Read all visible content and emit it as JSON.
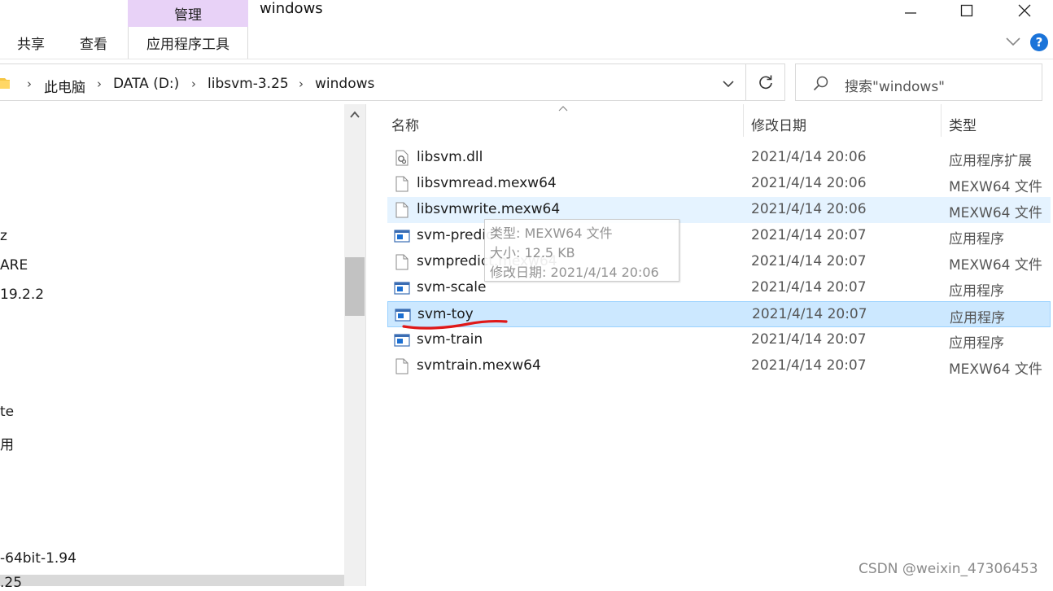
{
  "window": {
    "title": "windows",
    "manage_tab": "管理",
    "minimize_icon": "minimize-icon",
    "maximize_icon": "maximize-icon",
    "close_icon": "close-icon"
  },
  "ribbon": {
    "tabs": [
      "共享",
      "查看"
    ],
    "app_tools_tab": "应用程序工具",
    "help_glyph": "?"
  },
  "address": {
    "breadcrumbs": [
      "此电脑",
      "DATA (D:)",
      "libsvm-3.25",
      "windows"
    ],
    "separator": "›",
    "search_placeholder": "搜索\"windows\""
  },
  "nav": {
    "items": [
      "z",
      "ARE",
      "19.2.2",
      "te",
      "用",
      "-64bit-1.94",
      ".25"
    ]
  },
  "columns": {
    "name": "名称",
    "modified": "修改日期",
    "type": "类型"
  },
  "files": [
    {
      "name": "libsvm.dll",
      "date": "2021/4/14 20:06",
      "type": "应用程序扩展",
      "icon": "dll-file-icon"
    },
    {
      "name": "libsvmread.mexw64",
      "date": "2021/4/14 20:06",
      "type": "MEXW64 文件",
      "icon": "blank-file-icon"
    },
    {
      "name": "libsvmwrite.mexw64",
      "date": "2021/4/14 20:06",
      "type": "MEXW64 文件",
      "icon": "blank-file-icon",
      "state": "hover"
    },
    {
      "name": "svm-predict",
      "date": "2021/4/14 20:07",
      "type": "应用程序",
      "icon": "application-icon"
    },
    {
      "name": "svmpredict.mexw64",
      "date": "2021/4/14 20:07",
      "type": "MEXW64 文件",
      "icon": "blank-file-icon"
    },
    {
      "name": "svm-scale",
      "date": "2021/4/14 20:07",
      "type": "应用程序",
      "icon": "application-icon"
    },
    {
      "name": "svm-toy",
      "date": "2021/4/14 20:07",
      "type": "应用程序",
      "icon": "application-icon",
      "state": "selected"
    },
    {
      "name": "svm-train",
      "date": "2021/4/14 20:07",
      "type": "应用程序",
      "icon": "application-icon"
    },
    {
      "name": "svmtrain.mexw64",
      "date": "2021/4/14 20:07",
      "type": "MEXW64 文件",
      "icon": "blank-file-icon"
    }
  ],
  "tooltip": {
    "type_line": "类型: MEXW64 文件",
    "size_line": "大小: 12.5 KB",
    "date_line": "修改日期: 2021/4/14 20:06"
  },
  "watermark": "CSDN @weixin_47306453",
  "colors": {
    "manage_tab_bg": "#e8d2f7",
    "selected_row_bg": "#cce8ff",
    "hover_row_bg": "#e5f3ff",
    "annotation_red": "#e01818",
    "help_blue": "#1a73d9"
  }
}
